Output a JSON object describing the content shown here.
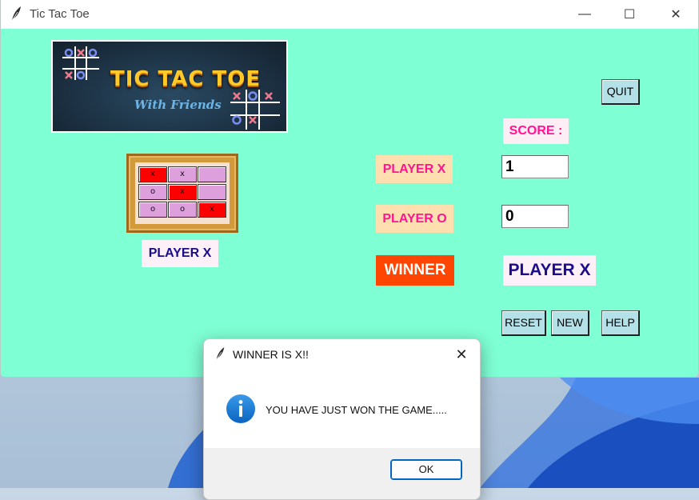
{
  "window": {
    "title": "Tic Tac Toe",
    "minimize_glyph": "—",
    "maximize_glyph": "☐",
    "close_glyph": "✕"
  },
  "banner": {
    "title": "TIC TAC TOE",
    "subtitle": "With Friends"
  },
  "board": {
    "cells": [
      {
        "mark": "x",
        "state": "win"
      },
      {
        "mark": "x",
        "state": "plain"
      },
      {
        "mark": "",
        "state": "plain"
      },
      {
        "mark": "o",
        "state": "plain"
      },
      {
        "mark": "x",
        "state": "win"
      },
      {
        "mark": "",
        "state": "plain"
      },
      {
        "mark": "o",
        "state": "plain"
      },
      {
        "mark": "o",
        "state": "plain"
      },
      {
        "mark": "x",
        "state": "win"
      }
    ]
  },
  "turn_label": "PLAYER X",
  "score": {
    "heading": "SCORE :",
    "player_x_label": "PLAYER X",
    "player_x_value": "1",
    "player_o_label": "PLAYER O",
    "player_o_value": "0"
  },
  "winner": {
    "label": "WINNER",
    "value": "PLAYER X"
  },
  "buttons": {
    "quit": "QUIT",
    "reset": "RESET",
    "new": "NEW",
    "help": "HELP"
  },
  "dialog": {
    "title": "WINNER IS X!!",
    "message": "YOU HAVE JUST WON THE GAME.....",
    "ok": "OK",
    "close_glyph": "✕",
    "icon": "info-icon"
  },
  "colors": {
    "window_bg": "#7fffd4",
    "winning_cell": "#ff0000",
    "empty_cell": "#dda0dd",
    "winner_label_bg": "#ff4500",
    "label_pink": "#ff1493",
    "label_navy": "#1a0d8c"
  }
}
